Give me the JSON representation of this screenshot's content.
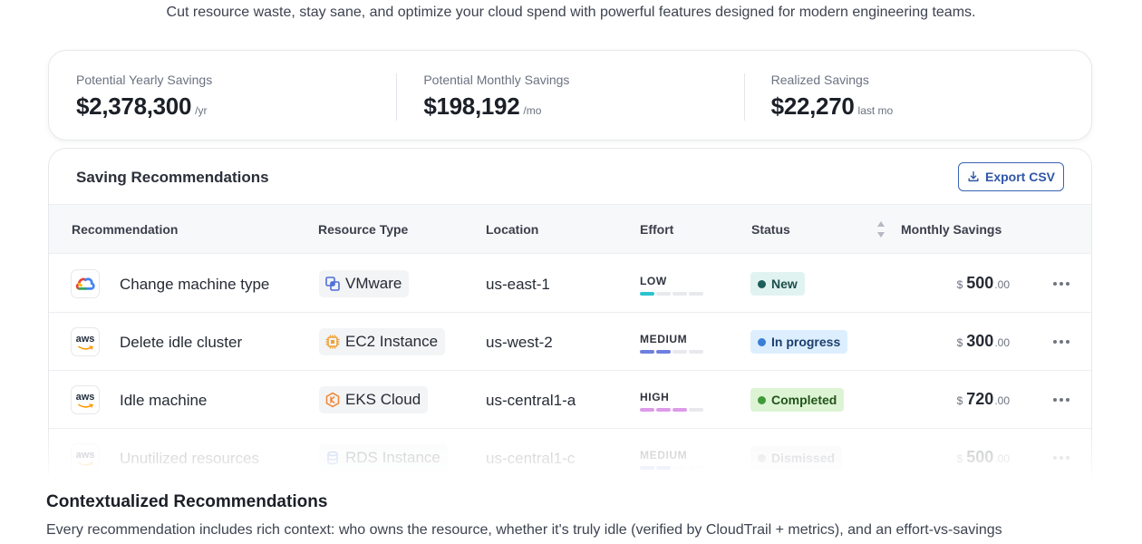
{
  "tagline": "Cut resource waste, stay sane, and optimize your cloud spend with powerful features designed for modern engineering teams.",
  "metrics": [
    {
      "label": "Potential Yearly Savings",
      "value": "$2,378,300",
      "unit": "/yr"
    },
    {
      "label": "Potential Monthly Savings",
      "value": "$198,192",
      "unit": "/mo"
    },
    {
      "label": "Realized Savings",
      "value": "$22,270",
      "unit": "last mo"
    }
  ],
  "recommendations_panel": {
    "title": "Saving Recommendations",
    "export_label": "Export CSV",
    "columns": [
      "Recommendation",
      "Resource Type",
      "Location",
      "Effort",
      "Status",
      "Monthly Savings"
    ],
    "rows": [
      {
        "provider": "google-cloud",
        "name": "Change machine type",
        "resource_icon": "vmware-icon",
        "resource": "VMware",
        "location": "us-east-1",
        "effort": "LOW",
        "effort_level": 1,
        "effort_color": "#2bc4cf",
        "status": "New",
        "status_bg": "#e1f3f1",
        "status_fg": "#1c4f4a",
        "status_dot": "#1e5f59",
        "currency": "$",
        "whole": "500",
        "cents": ".00"
      },
      {
        "provider": "aws",
        "name": "Delete idle cluster",
        "resource_icon": "ec2-chip-icon",
        "resource": "EC2 Instance",
        "location": "us-west-2",
        "effort": "MEDIUM",
        "effort_level": 2,
        "effort_color": "#6f7fe0",
        "status": "In progress",
        "status_bg": "#ddefff",
        "status_fg": "#1d3f6e",
        "status_dot": "#3b7fd6",
        "currency": "$",
        "whole": "300",
        "cents": ".00"
      },
      {
        "provider": "aws",
        "name": "Idle machine",
        "resource_icon": "eks-cloud-icon",
        "resource": "EKS Cloud",
        "location": "us-central1-a",
        "effort": "HIGH",
        "effort_level": 3,
        "effort_color": "#dc9be8",
        "status": "Completed",
        "status_bg": "#dcf4d3",
        "status_fg": "#24531c",
        "status_dot": "#3f9b3a",
        "currency": "$",
        "whole": "720",
        "cents": ".00"
      },
      {
        "provider": "aws",
        "name": "Unutilized resources",
        "resource_icon": "rds-database-icon",
        "resource": "RDS Instance",
        "location": "us-central1-c",
        "effort": "MEDIUM",
        "effort_level": 2,
        "effort_color": "#6f7fe0",
        "status": "Dismissed",
        "status_bg": "#eef0f3",
        "status_fg": "#5b616c",
        "status_dot": "#9aa0aa",
        "currency": "$",
        "whole": "500",
        "cents": ".00"
      }
    ]
  },
  "section": {
    "title": "Contextualized Recommendations",
    "body": "Every recommendation includes rich context: who owns the resource, whether it's truly idle (verified by CloudTrail + metrics), and an effort-vs-savings"
  },
  "colors": {
    "accent": "#2f56a8",
    "border": "#e6e8ec"
  }
}
